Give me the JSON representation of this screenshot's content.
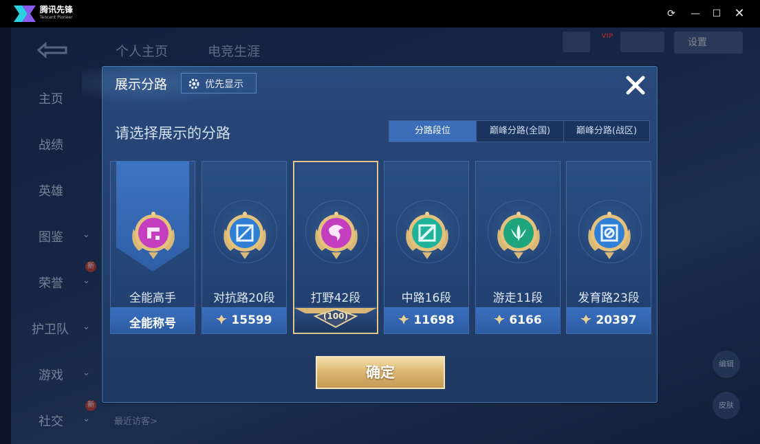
{
  "window": {
    "app_name": "腾讯先锋",
    "app_subtitle": "Tencent Pioneer",
    "controls": [
      "refresh-icon",
      "minimize-icon",
      "maximize-icon",
      "close-icon"
    ]
  },
  "background": {
    "top_tabs": [
      "个人主页",
      "电竞生涯"
    ],
    "nav": [
      {
        "label": "主页",
        "has_chevron": false,
        "new": false
      },
      {
        "label": "战绩",
        "has_chevron": false,
        "new": false
      },
      {
        "label": "英雄",
        "has_chevron": false,
        "new": false
      },
      {
        "label": "图鉴",
        "has_chevron": true,
        "new": false
      },
      {
        "label": "荣誉",
        "has_chevron": true,
        "new": true
      },
      {
        "label": "护卫队",
        "has_chevron": true,
        "new": false
      },
      {
        "label": "游戏",
        "has_chevron": true,
        "new": false
      },
      {
        "label": "社交",
        "has_chevron": true,
        "new": true
      }
    ],
    "new_badge": "新",
    "recent_visitors": "最近访客>",
    "right_chip": "设置",
    "right_buttons": [
      "编辑",
      "皮肤"
    ]
  },
  "dialog": {
    "title": "展示分路",
    "priority_label": "优先显示",
    "subtitle": "请选择展示的分路",
    "tabs": [
      {
        "label": "分路段位",
        "active": true
      },
      {
        "label": "巅峰分路(全国)",
        "active": false
      },
      {
        "label": "巅峰分路(战区)",
        "active": false
      }
    ],
    "cards": [
      {
        "name": "全能高手",
        "footer": "全能称号",
        "footer_has_icon": false,
        "selected": false,
        "color": "#c43fbf"
      },
      {
        "name": "对抗路20段",
        "footer": "15599",
        "footer_has_icon": true,
        "selected": false,
        "color": "#2f7fd6"
      },
      {
        "name": "打野42段",
        "footer": "100",
        "footer_has_icon": false,
        "selected": true,
        "color": "#c43fbf"
      },
      {
        "name": "中路16段",
        "footer": "11698",
        "footer_has_icon": true,
        "selected": false,
        "color": "#21b39a"
      },
      {
        "name": "游走11段",
        "footer": "6166",
        "footer_has_icon": true,
        "selected": false,
        "color": "#1ea57e"
      },
      {
        "name": "发育路23段",
        "footer": "20397",
        "footer_has_icon": true,
        "selected": false,
        "color": "#2f7fd6"
      }
    ],
    "confirm_label": "确定"
  },
  "colors": {
    "accent_blue": "#3b6db8",
    "gold": "#dcb873",
    "selected_border": "#e3c68a"
  }
}
